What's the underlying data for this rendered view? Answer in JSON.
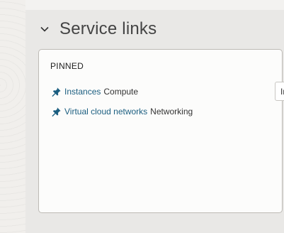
{
  "section": {
    "title": "Service links",
    "chevron_icon": "chevron-down-icon"
  },
  "pinned": {
    "label": "PINNED",
    "items": [
      {
        "icon": "pin-icon",
        "link": "Instances",
        "service": "Compute"
      },
      {
        "icon": "pin-icon",
        "link": "Virtual cloud networks",
        "service": "Networking"
      }
    ]
  },
  "tooltip": {
    "text": "In"
  },
  "colors": {
    "link": "#1b5e80",
    "pin": "#1b5e80",
    "panel_bg": "#e9e8e6",
    "card_bg": "#fcfcfb"
  }
}
